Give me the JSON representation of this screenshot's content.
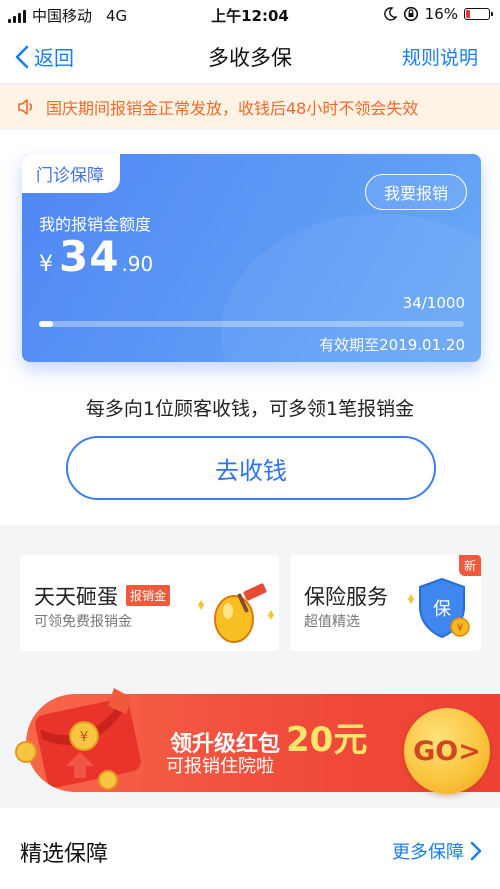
{
  "status_bar": {
    "carrier": "中国移动",
    "network": "4G",
    "time": "上午12:04",
    "battery": "16%"
  },
  "nav": {
    "back_label": "返回",
    "title": "多收多保",
    "rules_label": "规则说明"
  },
  "notice": {
    "text": "国庆期间报销金正常发放，收钱后48小时不领会失效"
  },
  "card": {
    "tag": "门诊保障",
    "action_label": "我要报销",
    "amount_label": "我的报销金额度",
    "currency": "¥",
    "amount_int": "34",
    "amount_dec": ".90",
    "progress_text": "34/1000",
    "progress_fraction": 0.034,
    "expiry": "有效期至2019.01.20"
  },
  "tip": "每多向1位顾客收钱，可多领1笔报销金",
  "collect_label": "去收钱",
  "tiles": [
    {
      "title": "天天砸蛋",
      "badge": "报销金",
      "sub": "可领免费报销金"
    },
    {
      "title": "保险服务",
      "sub": "超值精选",
      "flag": "新",
      "shield_char": "保"
    }
  ],
  "banner": {
    "title_prefix": "领升级红包",
    "amount": "20元",
    "sub": "可报销住院啦",
    "go_label": "GO>"
  },
  "section": {
    "title": "精选保障",
    "more_label": "更多保障"
  },
  "colors": {
    "primary_blue": "#1a7ef0",
    "card_blue": "#4f87f3",
    "notice_orange": "#f06a2a",
    "banner_red": "#f04a3a"
  }
}
